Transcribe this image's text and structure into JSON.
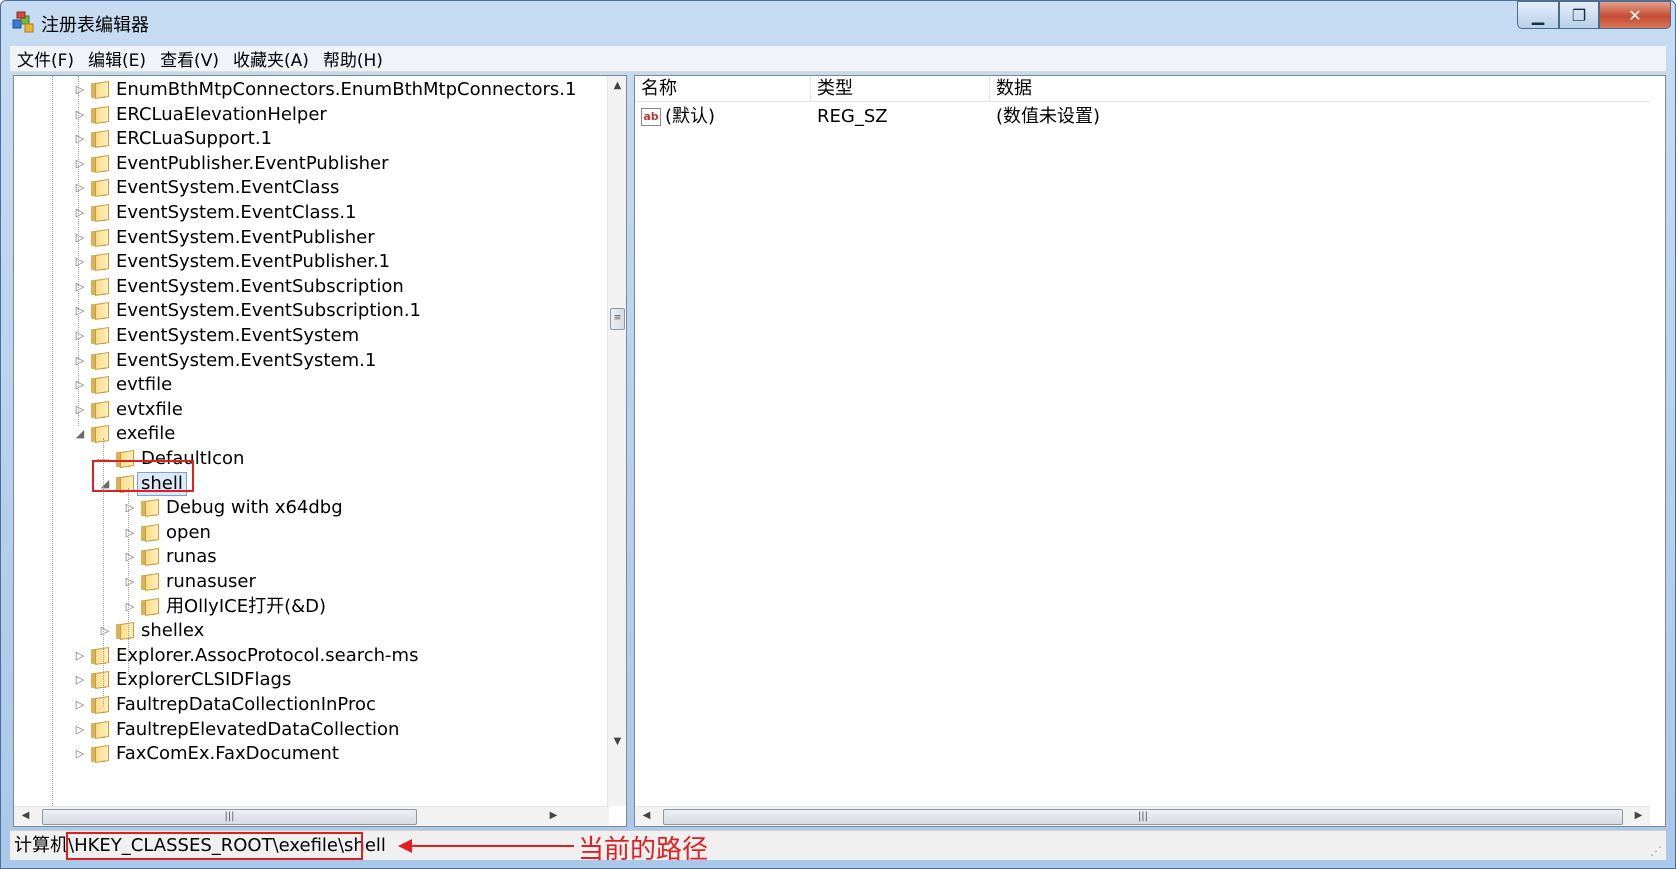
{
  "window": {
    "title": "注册表编辑器"
  },
  "menu": [
    "文件(F)",
    "编辑(E)",
    "查看(V)",
    "收藏夹(A)",
    "帮助(H)"
  ],
  "tree": {
    "items": [
      {
        "label": "EnumBthMtpConnectors.EnumBthMtpConnectors.1",
        "level": 0,
        "expander": "collapsed"
      },
      {
        "label": "ERCLuaElevationHelper",
        "level": 0,
        "expander": "collapsed"
      },
      {
        "label": "ERCLuaSupport.1",
        "level": 0,
        "expander": "collapsed"
      },
      {
        "label": "EventPublisher.EventPublisher",
        "level": 0,
        "expander": "collapsed"
      },
      {
        "label": "EventSystem.EventClass",
        "level": 0,
        "expander": "collapsed"
      },
      {
        "label": "EventSystem.EventClass.1",
        "level": 0,
        "expander": "collapsed"
      },
      {
        "label": "EventSystem.EventPublisher",
        "level": 0,
        "expander": "collapsed"
      },
      {
        "label": "EventSystem.EventPublisher.1",
        "level": 0,
        "expander": "collapsed"
      },
      {
        "label": "EventSystem.EventSubscription",
        "level": 0,
        "expander": "collapsed"
      },
      {
        "label": "EventSystem.EventSubscription.1",
        "level": 0,
        "expander": "collapsed"
      },
      {
        "label": "EventSystem.EventSystem",
        "level": 0,
        "expander": "collapsed"
      },
      {
        "label": "EventSystem.EventSystem.1",
        "level": 0,
        "expander": "collapsed"
      },
      {
        "label": "evtfile",
        "level": 0,
        "expander": "collapsed"
      },
      {
        "label": "evtxfile",
        "level": 0,
        "expander": "collapsed"
      },
      {
        "label": "exefile",
        "level": 0,
        "expander": "expanded"
      },
      {
        "label": "DefaultIcon",
        "level": 1,
        "expander": "none"
      },
      {
        "label": "shell",
        "level": 1,
        "expander": "expanded",
        "selected": true
      },
      {
        "label": "Debug with x64dbg",
        "level": 2,
        "expander": "collapsed"
      },
      {
        "label": "open",
        "level": 2,
        "expander": "collapsed"
      },
      {
        "label": "runas",
        "level": 2,
        "expander": "collapsed"
      },
      {
        "label": "runasuser",
        "level": 2,
        "expander": "collapsed"
      },
      {
        "label": "用OllyICE打开(&D)",
        "level": 2,
        "expander": "collapsed"
      },
      {
        "label": "shellex",
        "level": 1,
        "expander": "collapsed"
      },
      {
        "label": "Explorer.AssocProtocol.search-ms",
        "level": 0,
        "expander": "collapsed"
      },
      {
        "label": "ExplorerCLSIDFlags",
        "level": 0,
        "expander": "collapsed"
      },
      {
        "label": "FaultrepDataCollectionInProc",
        "level": 0,
        "expander": "collapsed"
      },
      {
        "label": "FaultrepElevatedDataCollection",
        "level": 0,
        "expander": "collapsed"
      },
      {
        "label": "FaxComEx.FaxDocument",
        "level": 0,
        "expander": "collapsed"
      }
    ]
  },
  "values": {
    "columns": [
      "名称",
      "类型",
      "数据"
    ],
    "rows": [
      {
        "icon": "ab",
        "name": "(默认)",
        "type": "REG_SZ",
        "data": "(数值未设置)"
      }
    ]
  },
  "status": {
    "prefix": "计算机",
    "path": "\\HKEY_CLASSES_ROOT\\exefile\\shell",
    "annotation": "当前的路径"
  },
  "colors": {
    "highlight": "#e02020",
    "selection": "#dbe9f8"
  },
  "icons": {
    "app": "registry-editor-icon",
    "folder": "folder-icon",
    "value": "string-value-icon"
  }
}
